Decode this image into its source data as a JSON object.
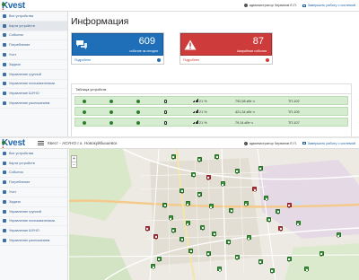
{
  "app": {
    "logo": {
      "k": "K",
      "vest": "vest",
      "dot": "."
    },
    "title": "Квест - АСУНО г.о. Новокуйбышевск",
    "user": "администратор Черватов Е.П.",
    "logout": "Завершить работу с системой"
  },
  "sidebar": {
    "items": [
      {
        "label": "Все устройства",
        "icon": "list-icon"
      },
      {
        "label": "Карта устройств",
        "icon": "map-icon"
      },
      {
        "label": "События",
        "icon": "events-icon"
      },
      {
        "label": "Потребление",
        "icon": "consumption-icon"
      },
      {
        "label": "Учет",
        "icon": "accounting-icon"
      },
      {
        "label": "Задачи",
        "icon": "tasks-icon"
      },
      {
        "label": "Управление группой",
        "icon": "group-icon"
      },
      {
        "label": "Управление пользователями",
        "icon": "users-icon"
      },
      {
        "label": "Управление ШУНО",
        "icon": "cabinet-icon"
      },
      {
        "label": "Управление расписанием",
        "icon": "schedule-icon"
      }
    ],
    "active_top": 1,
    "active_bottom": -1
  },
  "dashboard": {
    "heading": "Информация",
    "cards": [
      {
        "value": "609",
        "caption": "событие за сегодня",
        "link": "Подробнее",
        "color": "#1e6fb8",
        "icon": "chat-bubbles-icon"
      },
      {
        "value": "87",
        "caption": "Аварийные события",
        "link": "Подробнее",
        "color": "#cd3b3b",
        "icon": "warning-icon"
      }
    ],
    "table_title": "Таблица устройств",
    "rows": [
      {
        "percent": "21 %",
        "energy": "792,58 кВт·ч",
        "station": "ТП-102"
      },
      {
        "percent": "21 %",
        "energy": "421,34 кВт·ч",
        "station": "ТП-105"
      },
      {
        "percent": "21 %",
        "energy": "79,14 кВт·ч",
        "station": "ТП-107"
      }
    ],
    "row_color": "#d5ecd0"
  },
  "map": {
    "zoom_in": "+",
    "zoom_out": "−",
    "markers": [
      {
        "status": "green",
        "x": 0.36,
        "y": 0.06
      },
      {
        "status": "green",
        "x": 0.45,
        "y": 0.08
      },
      {
        "status": "green",
        "x": 0.51,
        "y": 0.06
      },
      {
        "status": "green",
        "x": 0.58,
        "y": 0.17
      },
      {
        "status": "green",
        "x": 0.66,
        "y": 0.15
      },
      {
        "status": "green",
        "x": 0.43,
        "y": 0.2
      },
      {
        "status": "red",
        "x": 0.48,
        "y": 0.22
      },
      {
        "status": "green",
        "x": 0.53,
        "y": 0.27
      },
      {
        "status": "red",
        "x": 0.64,
        "y": 0.31
      },
      {
        "status": "green",
        "x": 0.39,
        "y": 0.32
      },
      {
        "status": "green",
        "x": 0.45,
        "y": 0.35
      },
      {
        "status": "green",
        "x": 0.41,
        "y": 0.42
      },
      {
        "status": "green",
        "x": 0.33,
        "y": 0.43
      },
      {
        "status": "green",
        "x": 0.49,
        "y": 0.44
      },
      {
        "status": "green",
        "x": 0.56,
        "y": 0.47
      },
      {
        "status": "green",
        "x": 0.61,
        "y": 0.42
      },
      {
        "status": "green",
        "x": 0.68,
        "y": 0.38
      },
      {
        "status": "green",
        "x": 0.72,
        "y": 0.48
      },
      {
        "status": "red",
        "x": 0.76,
        "y": 0.43
      },
      {
        "status": "green",
        "x": 0.69,
        "y": 0.54
      },
      {
        "status": "red",
        "x": 0.73,
        "y": 0.61
      },
      {
        "status": "green",
        "x": 0.79,
        "y": 0.57
      },
      {
        "status": "green",
        "x": 0.35,
        "y": 0.53
      },
      {
        "status": "red",
        "x": 0.27,
        "y": 0.61
      },
      {
        "status": "green",
        "x": 0.36,
        "y": 0.62
      },
      {
        "status": "green",
        "x": 0.41,
        "y": 0.57
      },
      {
        "status": "green",
        "x": 0.46,
        "y": 0.6
      },
      {
        "status": "red",
        "x": 0.3,
        "y": 0.67
      },
      {
        "status": "green",
        "x": 0.39,
        "y": 0.69
      },
      {
        "status": "green",
        "x": 0.5,
        "y": 0.65
      },
      {
        "status": "green",
        "x": 0.55,
        "y": 0.71
      },
      {
        "status": "green",
        "x": 0.62,
        "y": 0.68
      },
      {
        "status": "green",
        "x": 0.42,
        "y": 0.78
      },
      {
        "status": "green",
        "x": 0.31,
        "y": 0.84
      },
      {
        "status": "green",
        "x": 0.48,
        "y": 0.8
      },
      {
        "status": "green",
        "x": 0.58,
        "y": 0.83
      },
      {
        "status": "green",
        "x": 0.66,
        "y": 0.86
      },
      {
        "status": "green",
        "x": 0.76,
        "y": 0.84
      },
      {
        "status": "green",
        "x": 0.87,
        "y": 0.8
      },
      {
        "status": "green",
        "x": 0.93,
        "y": 0.66
      },
      {
        "status": "green",
        "x": 0.29,
        "y": 0.9
      },
      {
        "status": "green",
        "x": 0.7,
        "y": 0.93
      },
      {
        "status": "green",
        "x": 0.82,
        "y": 0.92
      },
      {
        "status": "green",
        "x": 0.52,
        "y": 0.92
      }
    ]
  }
}
